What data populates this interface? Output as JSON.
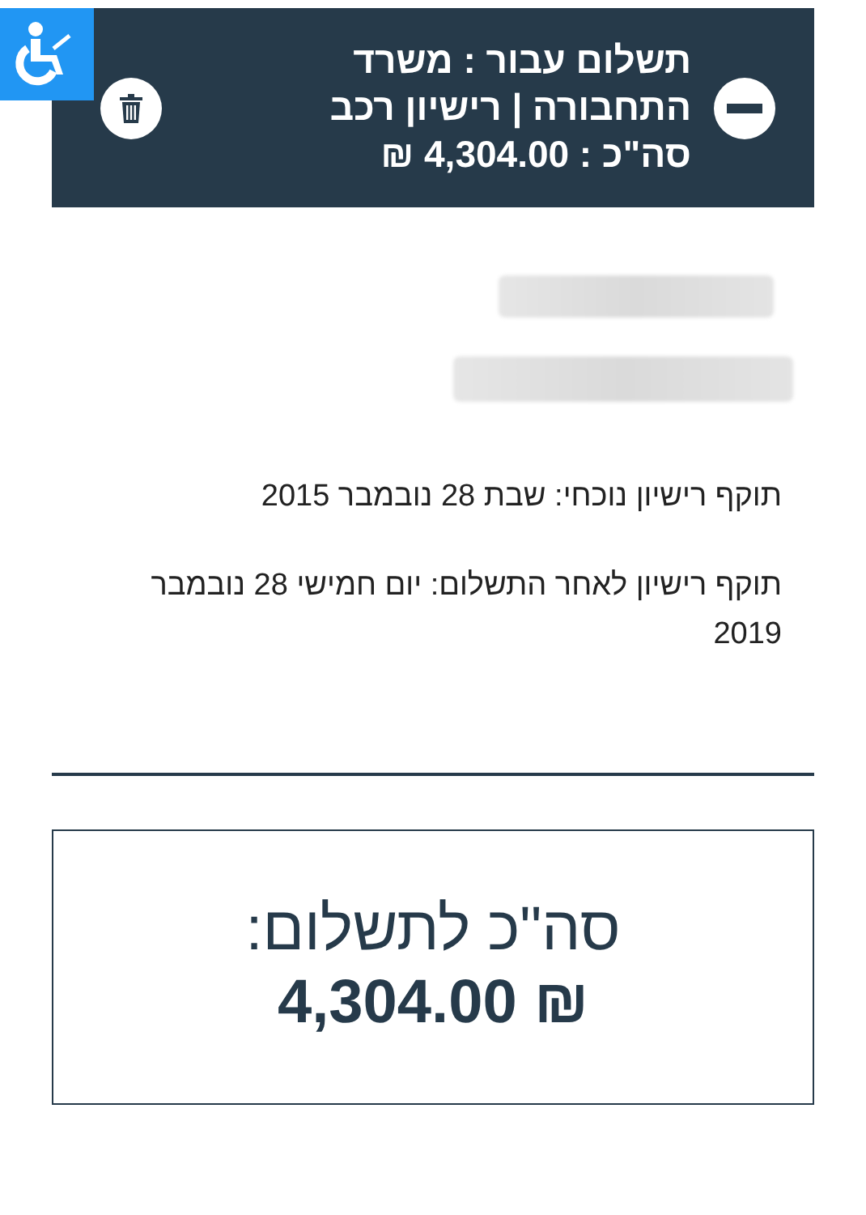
{
  "header": {
    "title": "תשלום עבור :  משרד התחבורה | רישיון רכב",
    "total": "סה\"כ : 4,304.00 ₪"
  },
  "details": [
    "תוקף רישיון נוכחי:  שבת 28 נובמבר 2015",
    "תוקף רישיון לאחר התשלום:  יום חמישי 28 נובמבר 2019"
  ],
  "summary": {
    "label": "סה\"כ לתשלום:",
    "amount": "₪ 4,304.00"
  }
}
